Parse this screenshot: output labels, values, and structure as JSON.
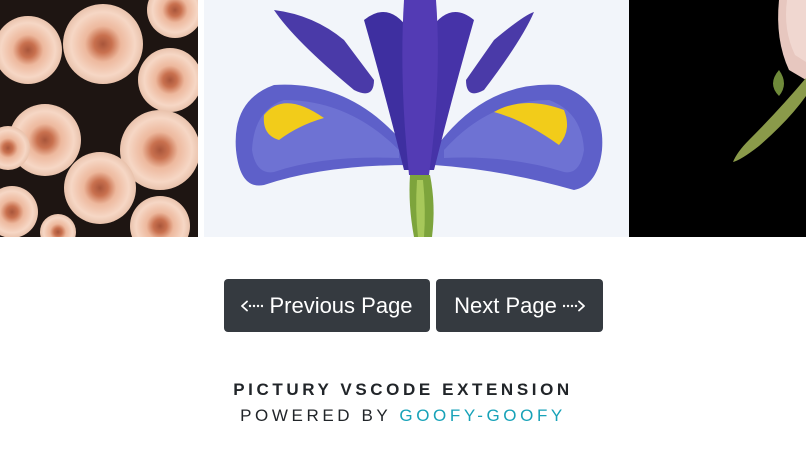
{
  "gallery": {
    "photos": [
      {
        "subject": "peach chrysanthemum flowers"
      },
      {
        "subject": "purple iris flower"
      },
      {
        "subject": "pink rose on black"
      }
    ]
  },
  "pagination": {
    "previous_label": "Previous Page",
    "next_label": "Next Page"
  },
  "footer": {
    "title": "PICTURY VSCODE EXTENSION",
    "powered_by": "POWERED BY",
    "link_text": "GOOFY-GOOFY"
  },
  "colors": {
    "button_background": "#353a40",
    "button_text": "#ffffff",
    "footer_text": "#212529",
    "link": "#17a2b8"
  }
}
